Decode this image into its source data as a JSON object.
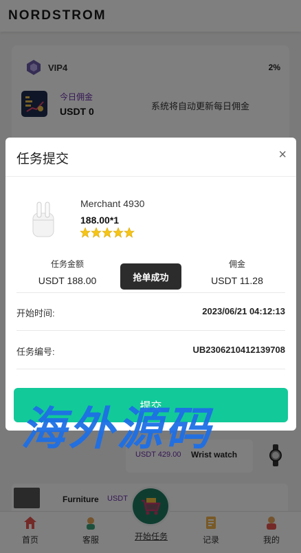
{
  "header": {
    "brand": "NORDSTROM"
  },
  "vip": {
    "level": "VIP4",
    "percent": "2%"
  },
  "commission": {
    "label": "今日佣金",
    "value": "USDT 0",
    "note": "系统将自动更新每日佣金"
  },
  "bg_orders": [
    {
      "price": "USDT 429.00",
      "name": "Wrist watch"
    },
    {
      "name": "Furniture",
      "price": "USDT"
    }
  ],
  "tabbar": {
    "home": "首页",
    "service": "客服",
    "start": "开始任务",
    "records": "记录",
    "mine": "我的"
  },
  "modal": {
    "title": "任务提交",
    "close": "×",
    "merchant": "Merchant 4930",
    "price_qty": "188.00*1",
    "rating": 5,
    "task_amount_label": "任务金额",
    "task_amount_value": "USDT  188.00",
    "commission_label": "佣金",
    "commission_value": "USDT  11.28",
    "start_time_label": "开始时间:",
    "start_time_value": "2023/06/21 04:12:13",
    "task_no_label": "任务编号:",
    "task_no_value": "UB2306210412139708",
    "submit": "提交"
  },
  "toast": "抢单成功",
  "watermark": "海外源码",
  "colors": {
    "accent_green": "#12c999",
    "purple_text": "#6b2fa8",
    "watermark_blue": "#1e6fe6"
  }
}
